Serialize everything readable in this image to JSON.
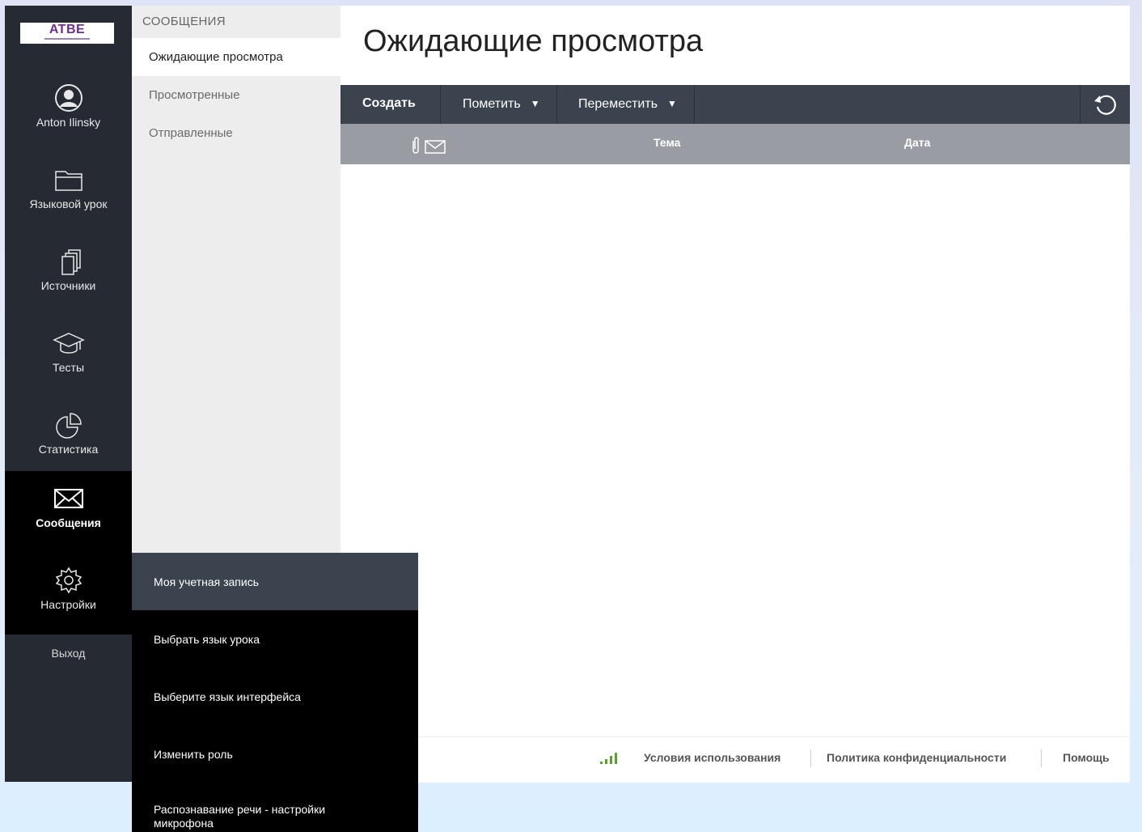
{
  "app": {
    "logo_text": "ATBE"
  },
  "rail": {
    "user_name": "Anton Ilinsky",
    "items": [
      {
        "label": "Языковой урок",
        "icon": "folder-icon"
      },
      {
        "label": "Источники",
        "icon": "documents-icon"
      },
      {
        "label": "Тесты",
        "icon": "graduation-cap-icon"
      },
      {
        "label": "Статистика",
        "icon": "pie-chart-icon"
      },
      {
        "label": "Сообщения",
        "icon": "envelope-icon",
        "active": true
      },
      {
        "label": "Настройки",
        "icon": "gear-icon"
      }
    ],
    "logout": "Выход"
  },
  "subnav": {
    "title": "СООБЩЕНИЯ",
    "items": [
      {
        "label": "Ожидающие просмотра",
        "active": true
      },
      {
        "label": "Просмотренные"
      },
      {
        "label": "Отправленные"
      }
    ]
  },
  "main": {
    "title": "Ожидающие просмотра",
    "toolbar": {
      "create": "Создать",
      "mark": "Пометить",
      "move": "Переместить"
    },
    "table": {
      "columns": [
        "Тема",
        "Дата"
      ],
      "rows": []
    }
  },
  "footer": {
    "terms": "Условия использования",
    "privacy": "Политика конфиденциальности",
    "help": "Помощь"
  },
  "settings_menu": {
    "items": [
      "Моя учетная запись",
      "Выбрать язык урока",
      "Выберите язык интерфейса",
      "Изменить роль",
      "Распознавание речи - настройки микрофона"
    ]
  },
  "colors": {
    "rail_bg": "#262b33",
    "toolbar_bg": "#3b434f",
    "table_header_bg": "#999da3",
    "subnav_bg": "#ededed",
    "signal_green": "#5aa02c",
    "logo_purple": "#6d2f8f"
  }
}
